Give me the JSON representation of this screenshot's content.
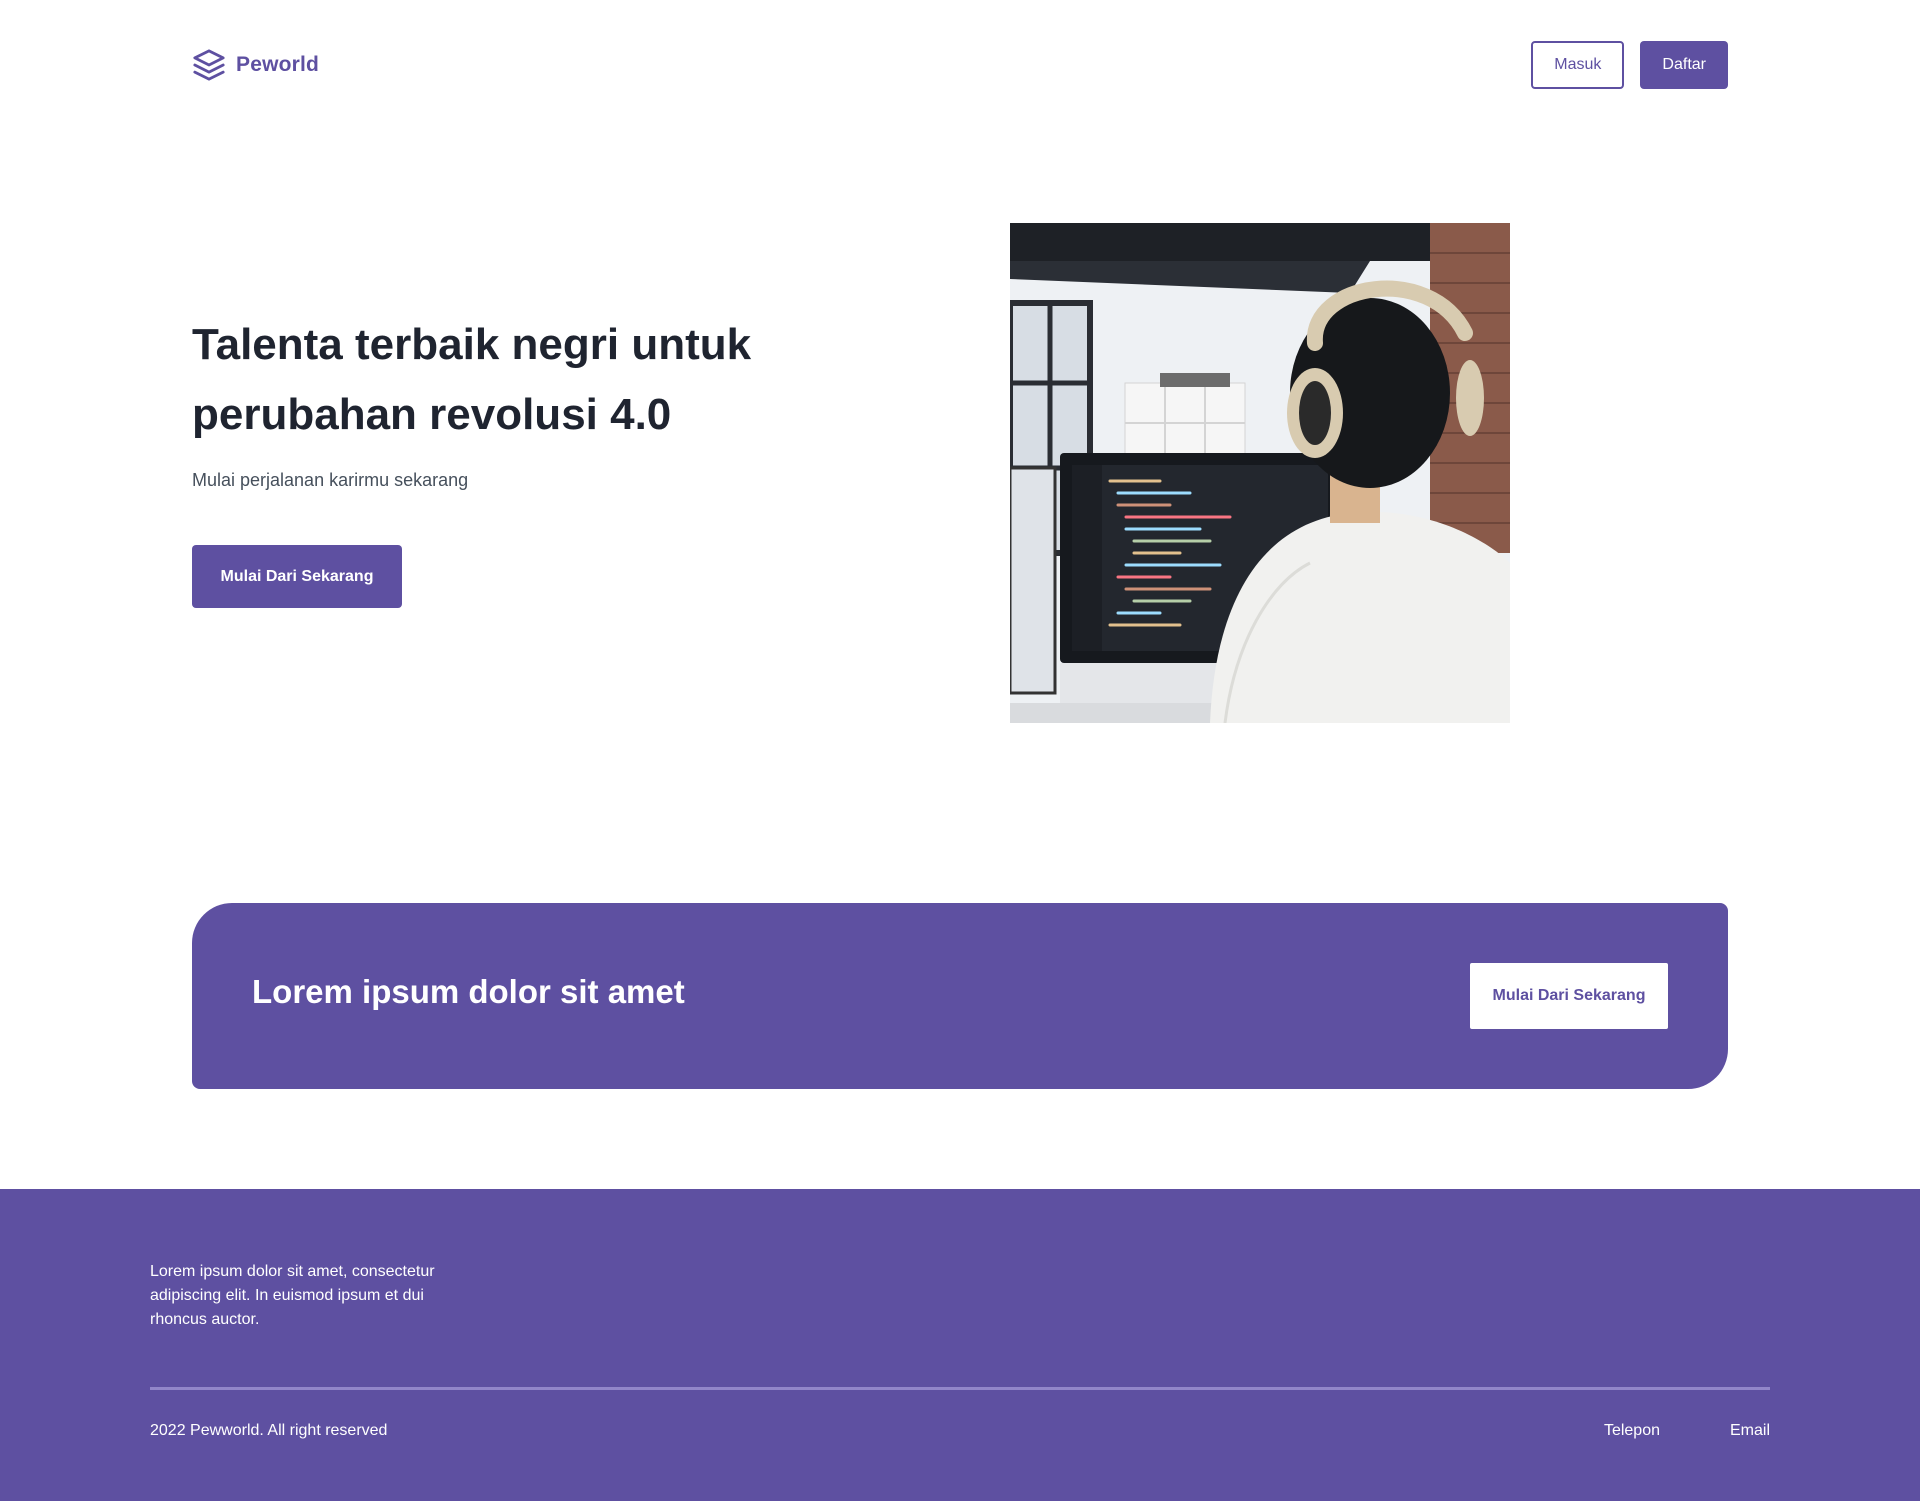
{
  "navbar": {
    "brand_name": "Peworld",
    "brand_icon": "stack-layers-icon",
    "login_label": "Masuk",
    "register_label": "Daftar"
  },
  "hero": {
    "title": "Talenta terbaik negri untuk perubahan revolusi 4.0",
    "subtitle": "Mulai perjalanan karirmu sekarang",
    "cta_label": "Mulai Dari Sekarang"
  },
  "banner": {
    "title": "Lorem ipsum dolor sit amet",
    "cta_label": "Mulai Dari Sekarang"
  },
  "footer": {
    "description": "Lorem ipsum dolor sit amet, consectetur adipiscing elit. In euismod ipsum et dui rhoncus auctor.",
    "copyright": "2022 Pewworld. All right reserved",
    "links": [
      "Telepon",
      "Email"
    ]
  },
  "colors": {
    "primary": "#5e50a1",
    "text_dark": "#1f2430",
    "text_muted": "#46505c",
    "white": "#ffffff"
  }
}
